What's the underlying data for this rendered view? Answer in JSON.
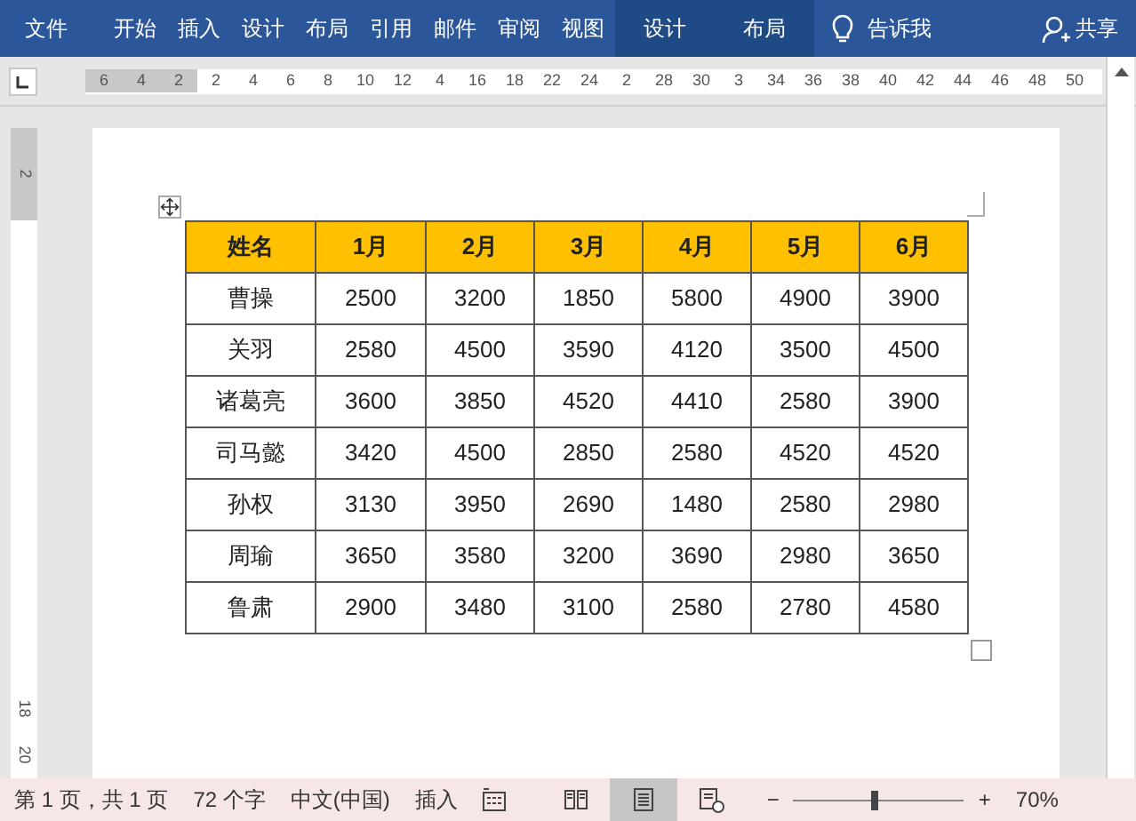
{
  "ribbon": {
    "tabs": [
      {
        "label": "文件",
        "kind": "file",
        "selected": false
      },
      {
        "label": "开始",
        "kind": "tab",
        "selected": false
      },
      {
        "label": "插入",
        "kind": "tab",
        "selected": false
      },
      {
        "label": "设计",
        "kind": "tab",
        "selected": false
      },
      {
        "label": "布局",
        "kind": "tab",
        "selected": false
      },
      {
        "label": "引用",
        "kind": "tab",
        "selected": false
      },
      {
        "label": "邮件",
        "kind": "tab",
        "selected": false
      },
      {
        "label": "审阅",
        "kind": "tab",
        "selected": false
      },
      {
        "label": "视图",
        "kind": "tab",
        "selected": false
      },
      {
        "label": "设计",
        "kind": "context",
        "selected": false
      },
      {
        "label": "布局",
        "kind": "context",
        "selected": false
      }
    ],
    "tell_me": "告诉我",
    "share": "共享"
  },
  "ruler": {
    "labels": [
      "6",
      "4",
      "2",
      "2",
      "4",
      "6",
      "8",
      "10",
      "12",
      "4",
      "16",
      "18",
      "22",
      "24",
      "2",
      "28",
      "30",
      "3",
      "34",
      "36",
      "38",
      "40",
      "42",
      "44",
      "46",
      "48",
      "50"
    ],
    "vertical_labels": [
      "2",
      "18",
      "20"
    ]
  },
  "table": {
    "columns": [
      "姓名",
      "1月",
      "2月",
      "3月",
      "4月",
      "5月",
      "6月"
    ],
    "rows": [
      [
        "曹操",
        "2500",
        "3200",
        "1850",
        "5800",
        "4900",
        "3900"
      ],
      [
        "关羽",
        "2580",
        "4500",
        "3590",
        "4120",
        "3500",
        "4500"
      ],
      [
        "诸葛亮",
        "3600",
        "3850",
        "4520",
        "4410",
        "2580",
        "3900"
      ],
      [
        "司马懿",
        "3420",
        "4500",
        "2850",
        "2580",
        "4520",
        "4520"
      ],
      [
        "孙权",
        "3130",
        "3950",
        "2690",
        "1480",
        "2580",
        "2980"
      ],
      [
        "周瑜",
        "3650",
        "3580",
        "3200",
        "3690",
        "2980",
        "3650"
      ],
      [
        "鲁肃",
        "2900",
        "3480",
        "3100",
        "2580",
        "2780",
        "4580"
      ]
    ]
  },
  "status_bar": {
    "page": "第 1 页，共 1 页",
    "words": "72 个字",
    "language": "中文(中国)",
    "mode": "插入",
    "views": [
      {
        "kind": "read",
        "selected": false
      },
      {
        "kind": "print",
        "selected": true
      },
      {
        "kind": "web",
        "selected": false
      }
    ],
    "zoom": {
      "minus": "−",
      "plus": "+",
      "level": 0.47,
      "reading": "70%"
    }
  }
}
